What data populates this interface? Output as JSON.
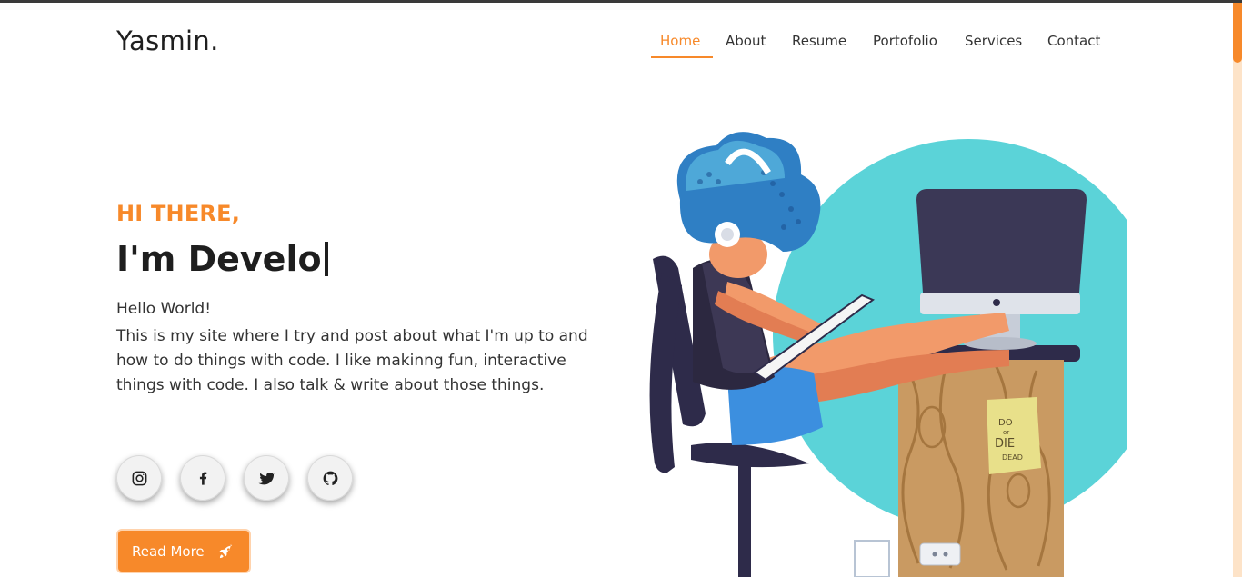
{
  "header": {
    "logo": "Yasmin.",
    "nav": [
      {
        "label": "Home",
        "active": true
      },
      {
        "label": "About",
        "active": false
      },
      {
        "label": "Resume",
        "active": false
      },
      {
        "label": "Portofolio",
        "active": false
      },
      {
        "label": "Services",
        "active": false
      },
      {
        "label": "Contact",
        "active": false
      }
    ]
  },
  "hero": {
    "greeting": "HI THERE,",
    "headline": "I'm Develo",
    "hello": "Hello World!",
    "description": "This is my site where I try and post about what I'm up to and how to do things with code. I like makinng fun, interactive things with code. I also talk & write about those things.",
    "socials": [
      "instagram-icon",
      "facebook-icon",
      "twitter-icon",
      "github-icon"
    ],
    "button_label": "Read More",
    "button_icon": "rocket-icon"
  },
  "colors": {
    "accent": "#f7892a",
    "text": "#1e1e1e",
    "circle": "#5bd3d8"
  },
  "illustration": {
    "sticky_note": [
      "DO",
      "or",
      "DIE",
      "DEAD"
    ]
  }
}
